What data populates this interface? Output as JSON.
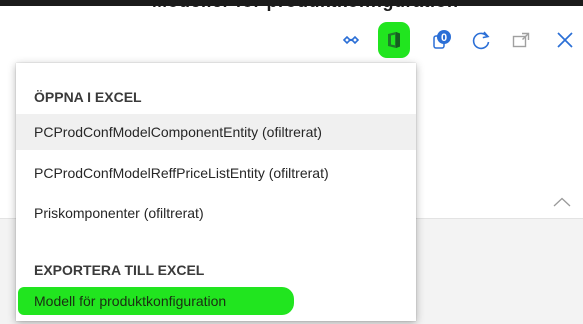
{
  "window": {
    "title_fragment": "Modeller för produktkonfiguration"
  },
  "toolbar": {
    "icons": [
      {
        "name": "diamond-link-icon",
        "color": "#2b6fd6"
      },
      {
        "name": "office-icon",
        "color": "#2e7d32",
        "highlight": "#21e51f"
      },
      {
        "name": "attachments-icon",
        "badge": "0",
        "color": "#2b6fd6"
      },
      {
        "name": "refresh-icon",
        "color": "#2b6fd6"
      },
      {
        "name": "open-new-window-icon",
        "color": "#9e9e9e"
      },
      {
        "name": "close-icon",
        "color": "#2b6fd6"
      }
    ]
  },
  "menu": {
    "open_section_header": "ÖPPNA I EXCEL",
    "open_items": [
      "PCProdConfModelComponentEntity (ofiltrerat)",
      "PCProdConfModelReffPriceListEntity (ofiltrerat)",
      "Priskomponenter (ofiltrerat)"
    ],
    "export_section_header": "EXPORTERA TILL EXCEL",
    "export_items": [
      "Modell för produktkonfiguration"
    ],
    "highlight_color": "#21e51f"
  }
}
